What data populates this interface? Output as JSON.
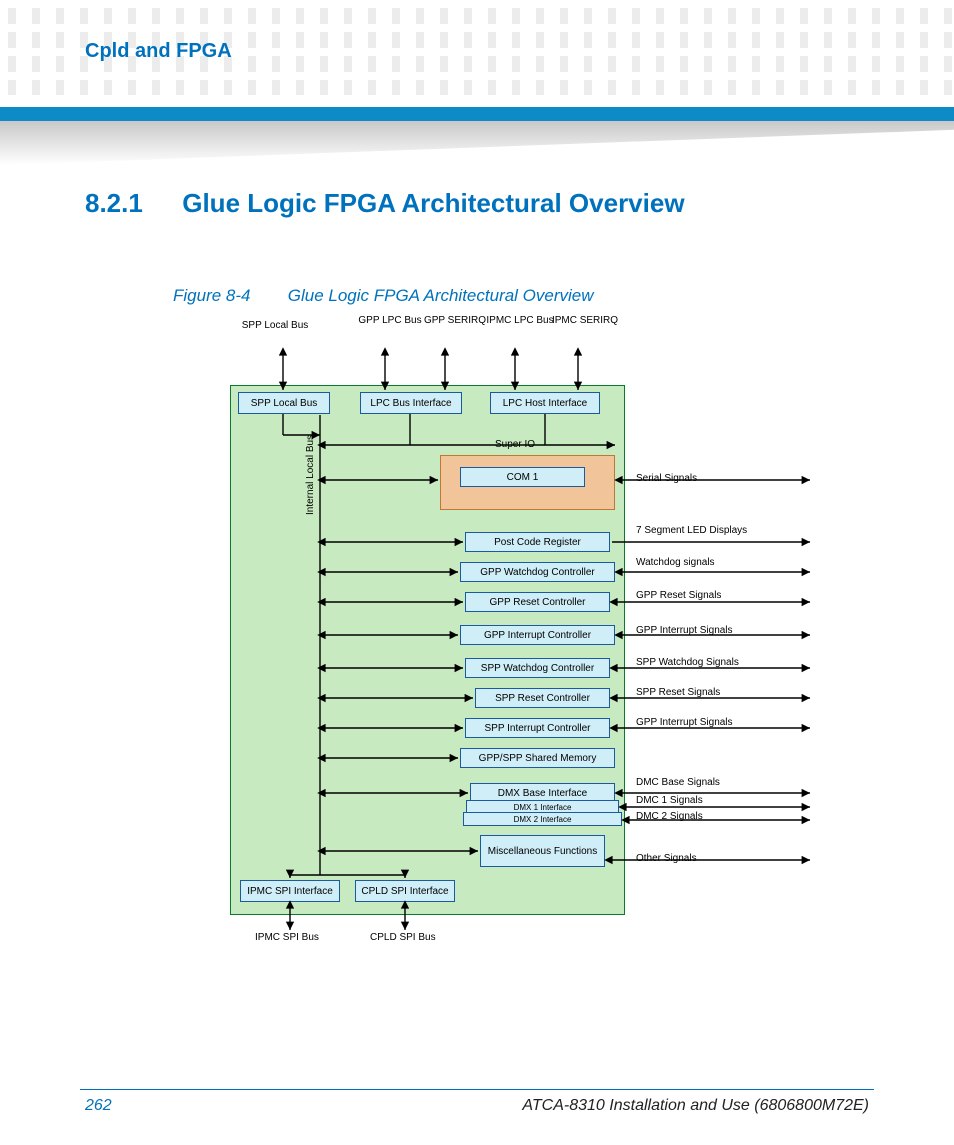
{
  "header": {
    "section_title": "Cpld and FPGA"
  },
  "heading": {
    "number": "8.2.1",
    "text": "Glue Logic FPGA Architectural Overview"
  },
  "figure": {
    "label": "Figure 8-4",
    "caption": "Glue Logic FPGA Architectural Overview"
  },
  "diagram": {
    "top_labels": [
      "SPP Local Bus",
      "GPP LPC Bus",
      "GPP SERIRQ",
      "IPMC LPC Bus",
      "IPMC SERIRQ"
    ],
    "top_row_boxes": [
      "SPP Local Bus",
      "LPC Bus Interface",
      "LPC Host Interface"
    ],
    "internal_bus_label": "Internal Local Bus",
    "super_io_label": "Super IO",
    "com_box": "COM 1",
    "mid_boxes": [
      "Post Code Register",
      "GPP Watchdog Controller",
      "GPP Reset Controller",
      "GPP Interrupt Controller",
      "SPP Watchdog Controller",
      "SPP Reset Controller",
      "SPP Interrupt Controller",
      "GPP/SPP Shared Memory",
      "DMX Base Interface",
      "DMX 1 Interface",
      "DMX 2 Interface",
      "Miscellaneous Functions"
    ],
    "bottom_boxes": [
      "IPMC SPI Interface",
      "CPLD SPI Interface"
    ],
    "bottom_labels": [
      "IPMC SPI Bus",
      "CPLD SPI Bus"
    ],
    "right_signals": [
      "Serial Signals",
      "7 Segment LED Displays",
      "Watchdog signals",
      "GPP Reset Signals",
      "GPP Interrupt Signals",
      "SPP Watchdog Signals",
      "SPP Reset Signals",
      "GPP Interrupt Signals",
      "DMC Base Signals",
      "DMC 1 Signals",
      "DMC 2 Signals",
      "Other Signals"
    ]
  },
  "footer": {
    "page": "262",
    "doctitle": "ATCA-8310 Installation and Use (6806800M72E)"
  }
}
